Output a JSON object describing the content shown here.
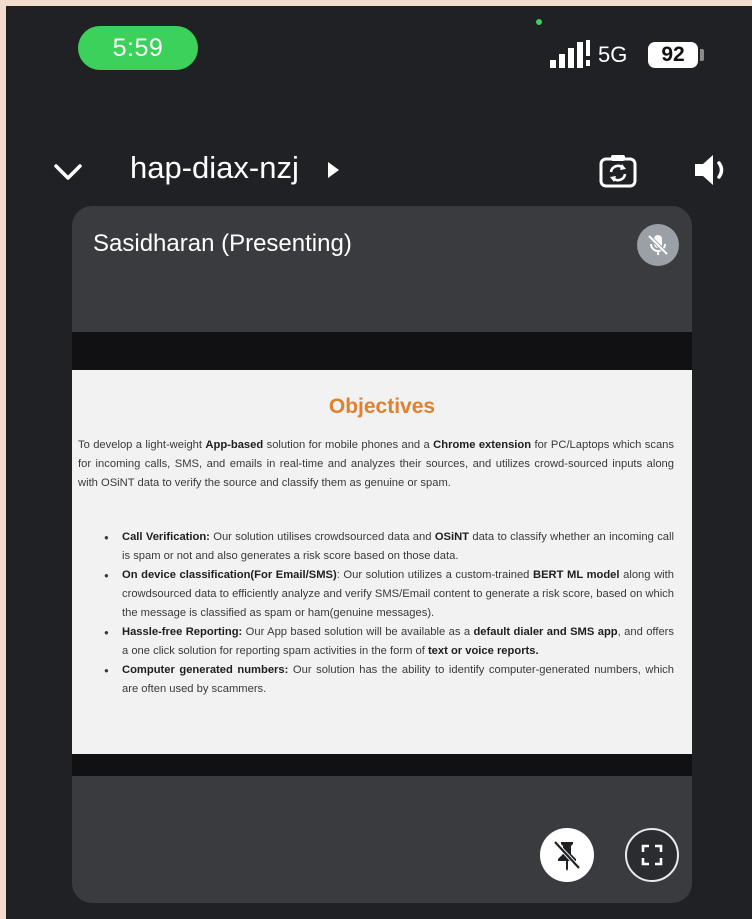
{
  "status_bar": {
    "time": "5:59",
    "network": "5G",
    "battery": "92"
  },
  "header": {
    "meeting_code": "hap-diax-nzj"
  },
  "tile": {
    "presenter": "Sasidharan (Presenting)"
  },
  "slide": {
    "title": "Objectives",
    "intro": [
      {
        "t": "To develop a light-weight "
      },
      {
        "t": "App-based",
        "b": true
      },
      {
        "t": " solution for mobile phones and a "
      },
      {
        "t": "Chrome extension",
        "b": true
      },
      {
        "t": " for PC/Laptops which scans for incoming calls, SMS, and emails in real-time and analyzes their sources, and utilizes crowd-sourced inputs along with OSiNT data to verify the source and classify them as genuine or spam."
      }
    ],
    "bullets": [
      [
        {
          "t": "Call Verification:",
          "b": true
        },
        {
          "t": " Our solution utilises crowdsourced data and "
        },
        {
          "t": "OSiNT",
          "b": true
        },
        {
          "t": " data to classify whether an incoming call is spam or not and also generates a risk score based on those data."
        }
      ],
      [
        {
          "t": "On device classification(For Email/SMS)",
          "b": true
        },
        {
          "t": ": Our solution utilizes a custom-trained "
        },
        {
          "t": "BERT ML model",
          "b": true
        },
        {
          "t": " along with crowdsourced data to efficiently analyze and verify SMS/Email content to generate a risk score, based on which the message is classified as spam or ham(genuine messages)."
        }
      ],
      [
        {
          "t": "Hassle-free Reporting:",
          "b": true
        },
        {
          "t": " Our App based solution will be available as a "
        },
        {
          "t": "default dialer and SMS app",
          "b": true
        },
        {
          "t": ", and offers a one click solution for reporting spam activities in the form of "
        },
        {
          "t": "text or voice reports.",
          "b": true
        }
      ],
      [
        {
          "t": "Computer generated numbers:",
          "b": true
        },
        {
          "t": " Our solution has the ability to identify computer-generated numbers, which are often used by scammers."
        }
      ]
    ]
  },
  "icons": {
    "back": "chevron-down-icon",
    "caret": "caret-right-icon",
    "switch_camera": "camera-switch-icon",
    "audio": "speaker-icon",
    "mic": "mic-off-icon",
    "pin": "unpin-icon",
    "fullscreen": "fullscreen-icon"
  },
  "colors": {
    "accent_green": "#3bd15a",
    "slide_title": "#e0812e",
    "background": "#202124"
  }
}
